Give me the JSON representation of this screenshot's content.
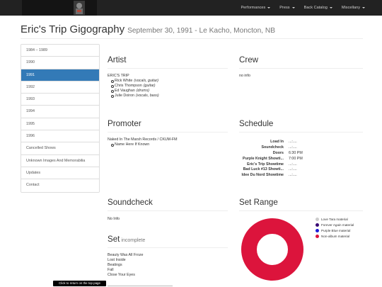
{
  "nav": {
    "items": [
      {
        "label": "Performances"
      },
      {
        "label": "Press"
      },
      {
        "label": "Back Catalog"
      },
      {
        "label": "Miscellany"
      }
    ]
  },
  "header": {
    "title": "Eric's Trip Gigography",
    "subtitle": "September 30, 1991 - Le Kacho, Moncton, NB"
  },
  "sidebar": {
    "items": [
      {
        "label": "1984 – 1989"
      },
      {
        "label": "1990"
      },
      {
        "label": "1991"
      },
      {
        "label": "1992"
      },
      {
        "label": "1993"
      },
      {
        "label": "1994"
      },
      {
        "label": "1995"
      },
      {
        "label": "1996"
      },
      {
        "label": "Cancelled Shows"
      },
      {
        "label": "Unknown Images And Memorabilia"
      },
      {
        "label": "Updates"
      },
      {
        "label": "Contact"
      }
    ],
    "active_index": 2
  },
  "artist": {
    "title": "Artist",
    "band": "ERIC'S TRIP",
    "members": [
      {
        "name": "Rick White",
        "role": "(vocals, guitar)"
      },
      {
        "name": "Chris Thompson",
        "role": "(guitar)"
      },
      {
        "name": "Ed Vaughan",
        "role": "(drums)"
      },
      {
        "name": "Julie Doiron",
        "role": "(vocals, bass)"
      }
    ]
  },
  "crew": {
    "title": "Crew",
    "text": "no info"
  },
  "promoter": {
    "title": "Promoter",
    "name": "Naked In The Marsh Records / CKUM-FM",
    "contacts": [
      {
        "name": "Name Here If Known"
      }
    ]
  },
  "schedule": {
    "title": "Schedule",
    "rows": [
      {
        "label": "Load In",
        "value": "...:...."
      },
      {
        "label": "Soundcheck",
        "value": "...:...."
      },
      {
        "label": "Doors",
        "value": "6:30 PM"
      },
      {
        "label": "Purple Knight Showti...",
        "value": "7:00 PM"
      },
      {
        "label": "Eric's Trip Showtime",
        "value": "...:...."
      },
      {
        "label": "Bad Luck #13 Showti...",
        "value": "...:...."
      },
      {
        "label": "Idee Du Nord Showtime",
        "value": "...:...."
      }
    ]
  },
  "soundcheck": {
    "title": "Soundcheck",
    "text": "No Info"
  },
  "set_range": {
    "title": "Set Range",
    "legend": [
      {
        "label": "Love Tara material",
        "color": "#cccccc"
      },
      {
        "label": "Forever Again material",
        "color": "#3a0a73"
      },
      {
        "label": "Purple Blue material",
        "color": "#1c1cd8"
      },
      {
        "label": "Non-album material",
        "color": "#dc143c"
      }
    ]
  },
  "set": {
    "title": "Set",
    "qualifier": "incomplete",
    "songs": [
      {
        "title": "Beauty Was All Froze"
      },
      {
        "title": "Lost Inside"
      },
      {
        "title": "Beatings"
      },
      {
        "title": "Fall"
      },
      {
        "title": "Close Your Eyes"
      }
    ]
  },
  "tooltip": {
    "text": "Click to return on the top page"
  },
  "colors": {
    "navbar": "#222222",
    "active": "#337ab7",
    "donut": "#dc143c"
  }
}
